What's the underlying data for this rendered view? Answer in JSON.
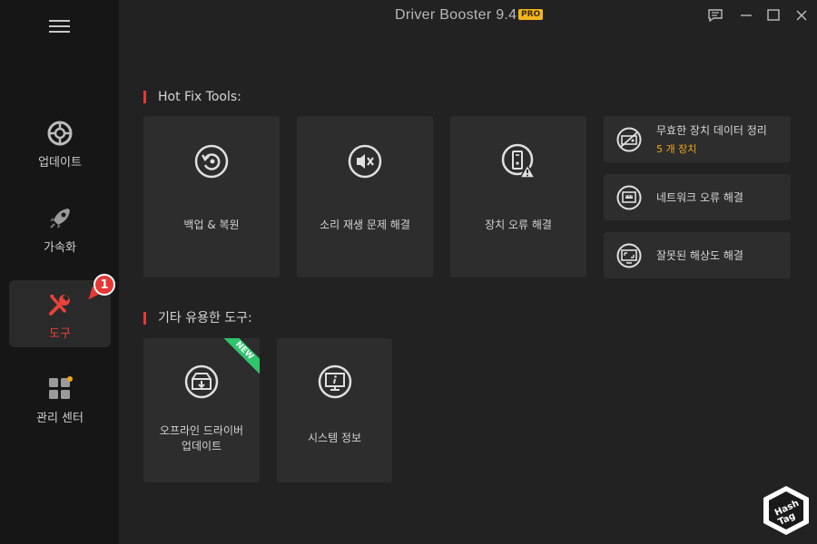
{
  "window": {
    "title": "Driver Booster 9.4",
    "pro_tag": "PRO"
  },
  "sidebar": {
    "items": [
      {
        "label": "업데이트",
        "icon": "update-icon"
      },
      {
        "label": "가속화",
        "icon": "rocket-icon"
      },
      {
        "label": "도구",
        "icon": "wrench-icon",
        "active": true
      },
      {
        "label": "관리 센터",
        "icon": "grid-icon"
      }
    ],
    "badge": "1"
  },
  "hotfix": {
    "title": "Hot Fix Tools:",
    "tiles": [
      {
        "label": "백업 & 복원",
        "icon": "restore-icon"
      },
      {
        "label": "소리 재생 문제 해결",
        "icon": "mute-icon"
      },
      {
        "label": "장치 오류 해결",
        "icon": "device-warning-icon"
      }
    ],
    "small_tiles": [
      {
        "label": "무효한 장치 데이터 정리",
        "sub": "5 개 장치",
        "icon": "invalid-device-icon"
      },
      {
        "label": "네트워크 오류 해결",
        "icon": "network-icon"
      },
      {
        "label": "잘못된 해상도 해결",
        "icon": "resolution-icon"
      }
    ]
  },
  "other": {
    "title": "기타 유용한 도구:",
    "tiles": [
      {
        "label_line1": "오프라인 드라이버",
        "label_line2": "업데이트",
        "icon": "offline-update-icon",
        "ribbon": "NEW"
      },
      {
        "label": "시스템 정보",
        "icon": "system-info-icon"
      }
    ]
  },
  "watermark": {
    "line1": "Hash",
    "line2": "Tag"
  },
  "colors": {
    "accent": "#e53935",
    "orange": "#f2a71c",
    "new_green": "#2ec46b"
  }
}
